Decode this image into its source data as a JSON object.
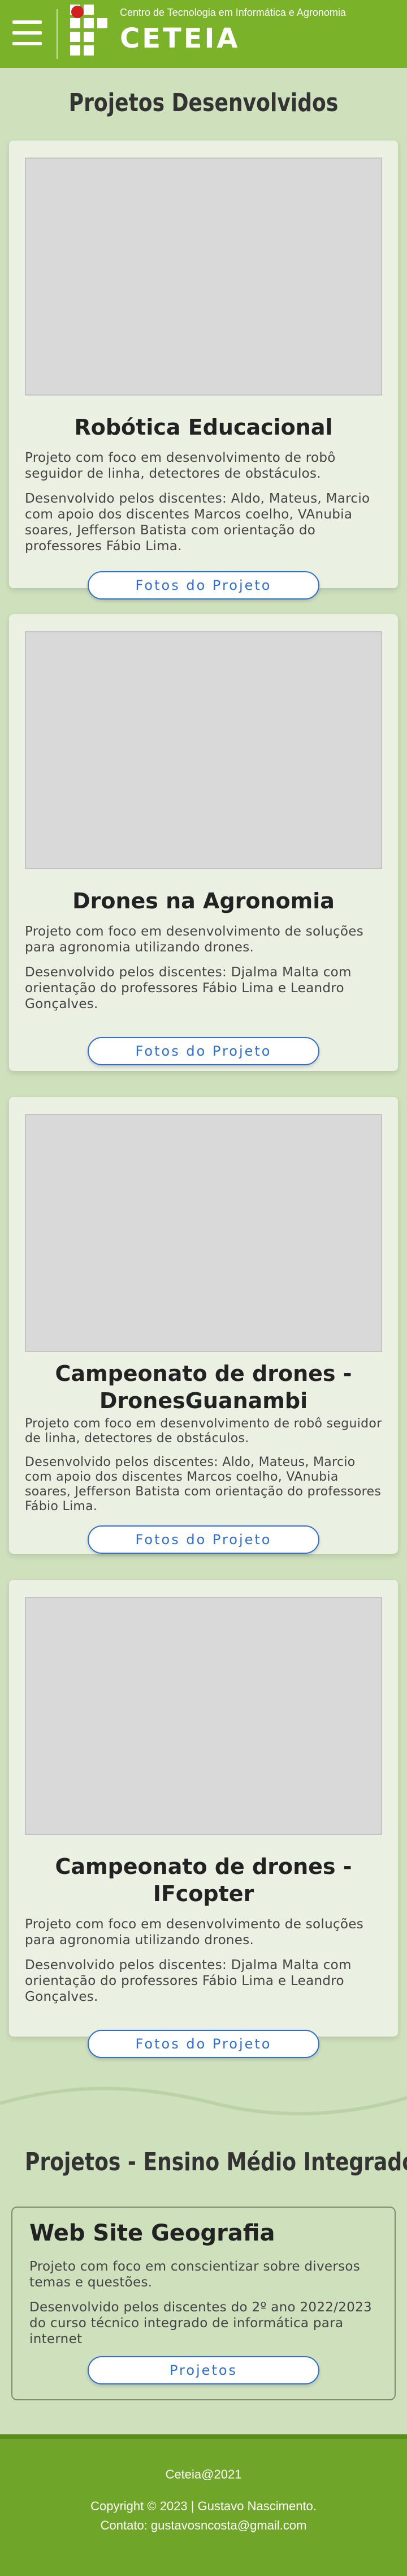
{
  "header": {
    "menu_icon": "hamburger-icon",
    "tagline": "Centro de Tecnologia em Informática e Agronomia",
    "brand": "CETEIA",
    "logo": "institute-logo"
  },
  "section1": {
    "title": "Projetos Desenvolvidos",
    "cards": [
      {
        "title": "Robótica Educacional",
        "desc": "Projeto com foco em desenvolvimento de robô seguidor de linha, detectores de obstáculos.",
        "authors": "Desenvolvido pelos discentes: Aldo, Mateus, Marcio com apoio dos discentes Marcos coelho, VAnubia soares, Jefferson Batista com orientação do professores Fábio Lima.",
        "button": "Fotos do Projeto"
      },
      {
        "title": "Drones na Agronomia",
        "desc": "Projeto com foco em desenvolvimento de soluções para agronomia utilizando drones.",
        "authors": "Desenvolvido pelos discentes: Djalma Malta com orientação do professores Fábio Lima e Leandro Gonçalves.",
        "button": "Fotos do Projeto"
      },
      {
        "title": "Campeonato de drones - DronesGuanambi",
        "desc": "Projeto com foco em desenvolvimento de robô seguidor de linha, detectores de obstáculos.",
        "authors": "Desenvolvido pelos discentes: Aldo, Mateus, Marcio com apoio dos discentes Marcos coelho, VAnubia soares, Jefferson Batista com orientação do professores Fábio Lima.",
        "button": "Fotos do Projeto"
      },
      {
        "title": "Campeonato de drones - IFcopter",
        "desc": "Projeto com foco em desenvolvimento de soluções para agronomia utilizando drones.",
        "authors": "Desenvolvido pelos discentes: Djalma Malta com orientação do professores Fábio Lima e Leandro Gonçalves.",
        "button": "Fotos do Projeto"
      }
    ]
  },
  "section2": {
    "title": "Projetos - Ensino Médio Integrado",
    "card": {
      "title": "Web Site Geografia",
      "desc": "Projeto com foco em conscientizar sobre diversos temas e questões.",
      "authors": "Desenvolvido pelos discentes do 2º ano 2022/2023 do curso técnico integrado de informática para internet",
      "button": "Projetos"
    }
  },
  "footer": {
    "site": "Ceteia@2021",
    "copyright": "Copyright © 2023 | Gustavo Nascimento.",
    "contact": "Contato: gustavosncosta@gmail.com"
  },
  "colors": {
    "header_green": "#7ab32a",
    "page_bg": "#cfe0bd",
    "card_bg": "#eaf0e2",
    "button_blue": "#2f6fd0",
    "footer_green": "#6fa528",
    "logo_red": "#d21f1f"
  }
}
